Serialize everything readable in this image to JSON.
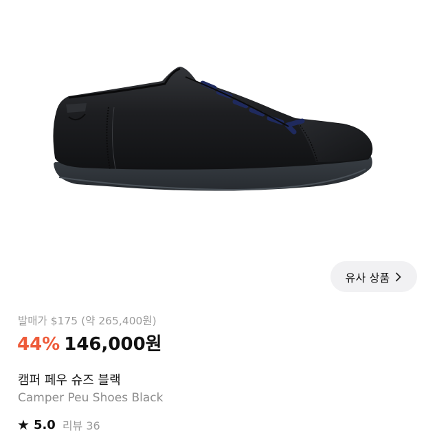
{
  "product": {
    "image_alt": "Camper Peu black leather sneaker with navy laces",
    "similar_button_label": "유사 상품",
    "release_price": "발매가 $175 (약 265,400원)",
    "discount": "44%",
    "price": "146,000원",
    "name_ko": "캠퍼 페우 슈즈 블랙",
    "name_en": "Camper Peu Shoes Black",
    "rating": "5.0",
    "review_count": "리뷰 36"
  },
  "colors": {
    "discount": "#ee5b3a",
    "muted_text": "#9a9a9a",
    "button_bg": "#f1f1f3",
    "shoe_leather": "#1b1c1e",
    "shoe_sole": "#30353a",
    "laces": "#1f2a5e"
  },
  "icons": {
    "chevron": "chevron-right-icon",
    "star": "star-icon"
  }
}
